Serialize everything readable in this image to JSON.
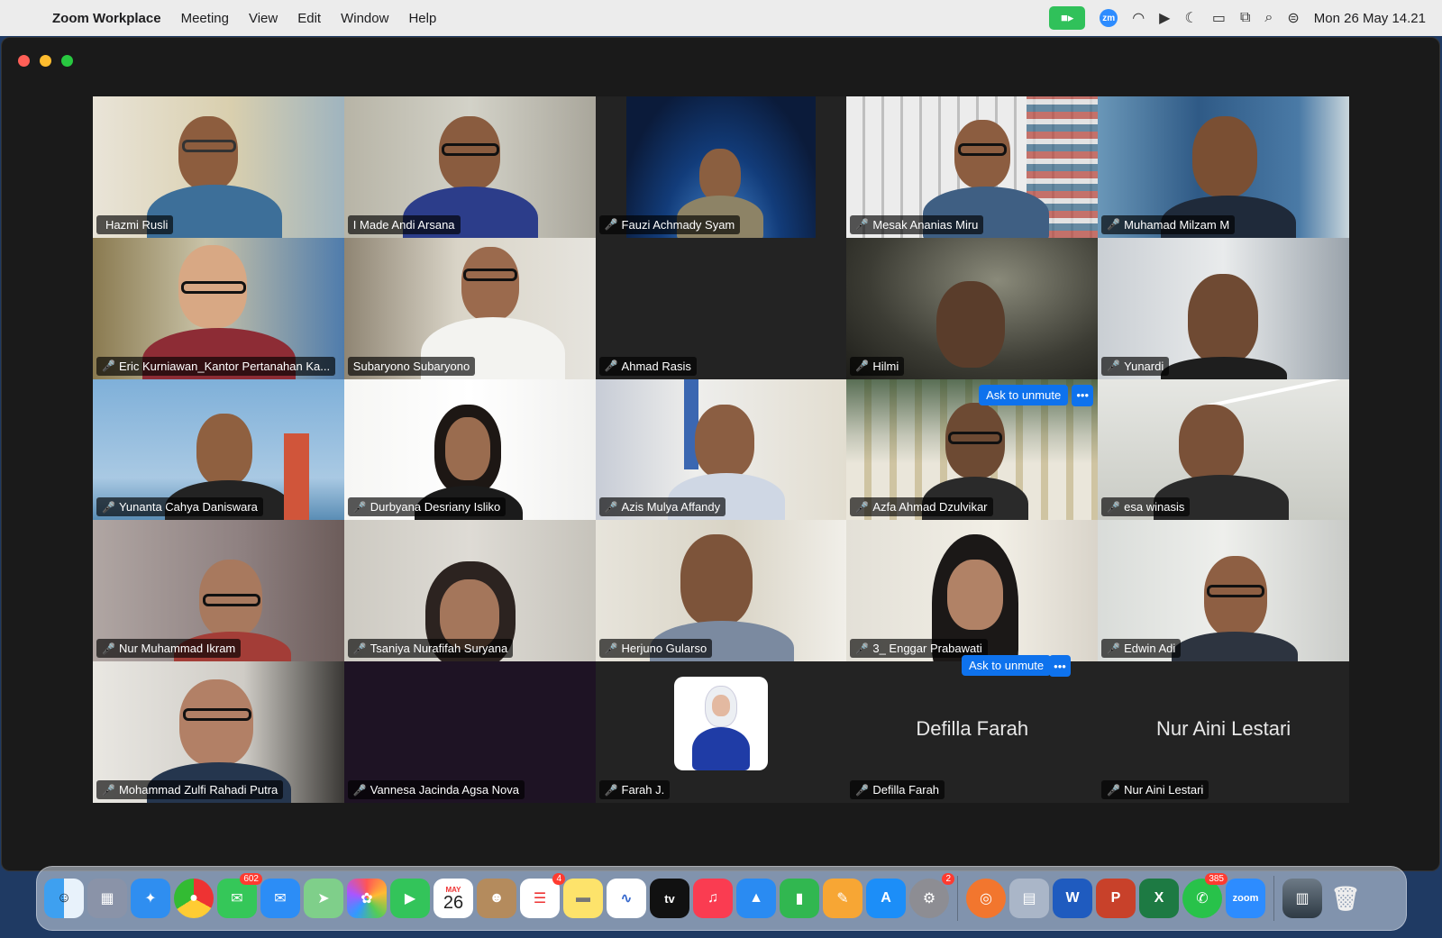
{
  "menubar": {
    "app": "Zoom Workplace",
    "items": [
      "Meeting",
      "View",
      "Edit",
      "Window",
      "Help"
    ],
    "clock": "Mon 26 May  14.21",
    "zm_label": "zm"
  },
  "participants": [
    {
      "name": "Hazmi Rusli",
      "muted": false
    },
    {
      "name": "I Made Andi Arsana",
      "muted": false,
      "active": true
    },
    {
      "name": "Fauzi Achmady Syam",
      "muted": true
    },
    {
      "name": "Mesak Ananias Miru",
      "muted": true
    },
    {
      "name": "Muhamad Milzam M",
      "muted": true
    },
    {
      "name": "Eric Kurniawan_Kantor Pertanahan Ka...",
      "muted": true
    },
    {
      "name": "Subaryono Subaryono",
      "muted": false
    },
    {
      "name": "Ahmad Rasis",
      "muted": true
    },
    {
      "name": "Hilmi",
      "muted": true
    },
    {
      "name": "Yunardi",
      "muted": true
    },
    {
      "name": "Yunanta Cahya Daniswara",
      "muted": true
    },
    {
      "name": "Durbyana Desriany Isliko",
      "muted": true
    },
    {
      "name": "Azis Mulya Affandy",
      "muted": true
    },
    {
      "name": "Azfa Ahmad Dzulvikar",
      "muted": true
    },
    {
      "name": "esa winasis",
      "muted": true
    },
    {
      "name": "Nur Muhammad Ikram",
      "muted": true
    },
    {
      "name": "Tsaniya Nurafifah Suryana",
      "muted": true
    },
    {
      "name": "Herjuno Gularso",
      "muted": true
    },
    {
      "name": "3_ Enggar Prabawati",
      "muted": true
    },
    {
      "name": "Edwin Adi",
      "muted": true
    },
    {
      "name": "Mohammad Zulfi Rahadi Putra",
      "muted": true
    },
    {
      "name": "Vannesa Jacinda Agsa Nova",
      "muted": true
    },
    {
      "name": "Farah J.",
      "muted": true
    },
    {
      "name": "Defilla Farah",
      "muted": true,
      "display_name": "Defilla Farah"
    },
    {
      "name": "Nur Aini Lestari",
      "muted": true,
      "display_name": "Nur Aini Lestari"
    }
  ],
  "ask_unmute_label": "Ask to unmute",
  "more_label": "•••",
  "dock": {
    "calendar_month": "MAY",
    "calendar_day": "26",
    "badges": {
      "messages": "602",
      "reminders": "4",
      "settings": "2",
      "whatsapp": "385"
    },
    "zoom_label": "zoom",
    "appletv_label": "tv"
  },
  "colors": {
    "active_border": "#2fbf5a",
    "ask_button": "#0e72ed",
    "mic_muted": "#e0413b"
  }
}
